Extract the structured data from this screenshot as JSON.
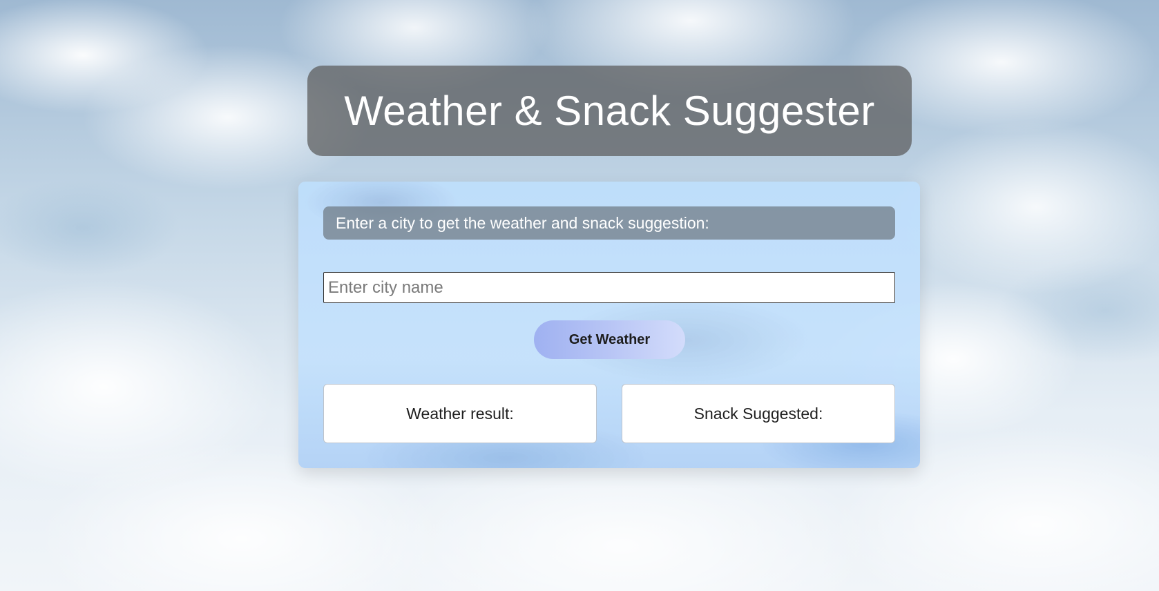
{
  "header": {
    "title": "Weather & Snack Suggester"
  },
  "main": {
    "instruction": "Enter a city to get the weather and snack suggestion:",
    "city_input": {
      "value": "",
      "placeholder": "Enter city name"
    },
    "get_weather_label": "Get Weather",
    "weather_result_label": "Weather result:",
    "snack_result_label": "Snack Suggested:"
  },
  "colors": {
    "title_bg": "#5a5a5a",
    "card_bg": "#bedefc",
    "button_gradient_start": "#9fb1f1",
    "button_gradient_end": "#d3dcfb"
  }
}
